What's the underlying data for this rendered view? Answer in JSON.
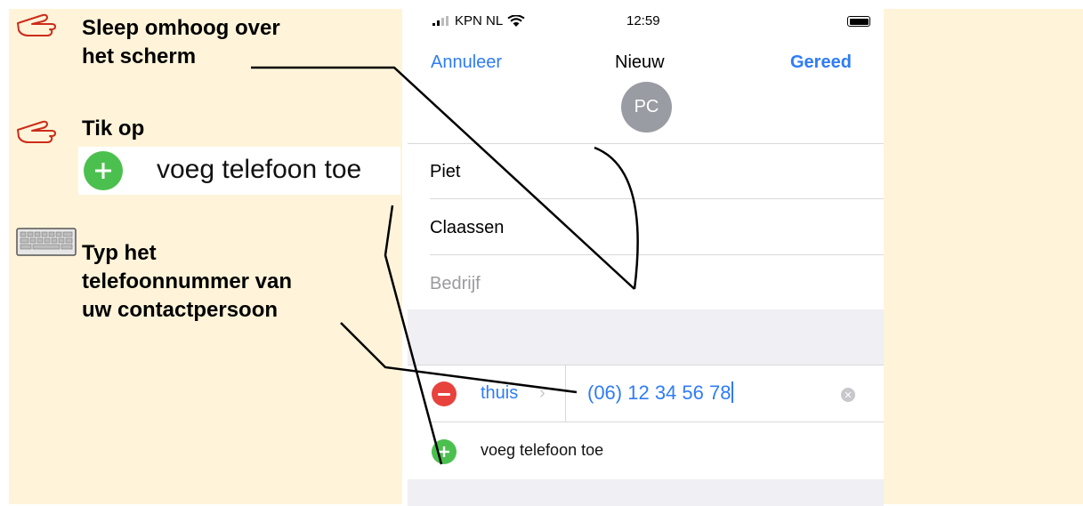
{
  "instructions": {
    "step1": [
      "Sleep omhoog over",
      "het scherm"
    ],
    "step2": "Tik op",
    "step2_demo_label": "voeg telefoon toe",
    "step3": [
      "Typ het",
      "telefoonnummer van",
      "uw contactpersoon"
    ],
    "icons": {
      "step1": "pointing-hand-icon",
      "step2": "pointing-hand-icon",
      "step3": "keyboard-icon"
    }
  },
  "phone": {
    "status": {
      "carrier": "KPN NL",
      "time": "12:59"
    },
    "nav": {
      "cancel": "Annuleer",
      "title": "Nieuw",
      "done": "Gereed"
    },
    "avatar_initials": "PC",
    "fields": {
      "first_name": "Piet",
      "last_name": "Claassen",
      "company_placeholder": "Bedrijf"
    },
    "phone_row": {
      "type": "thuis",
      "number": "(06) 12 34 56 78"
    },
    "add_phone": "voeg telefoon toe"
  },
  "colors": {
    "accent": "#2f7cf6",
    "add": "#4cc04f",
    "delete": "#e8423d",
    "panel": "#fff4d9"
  }
}
